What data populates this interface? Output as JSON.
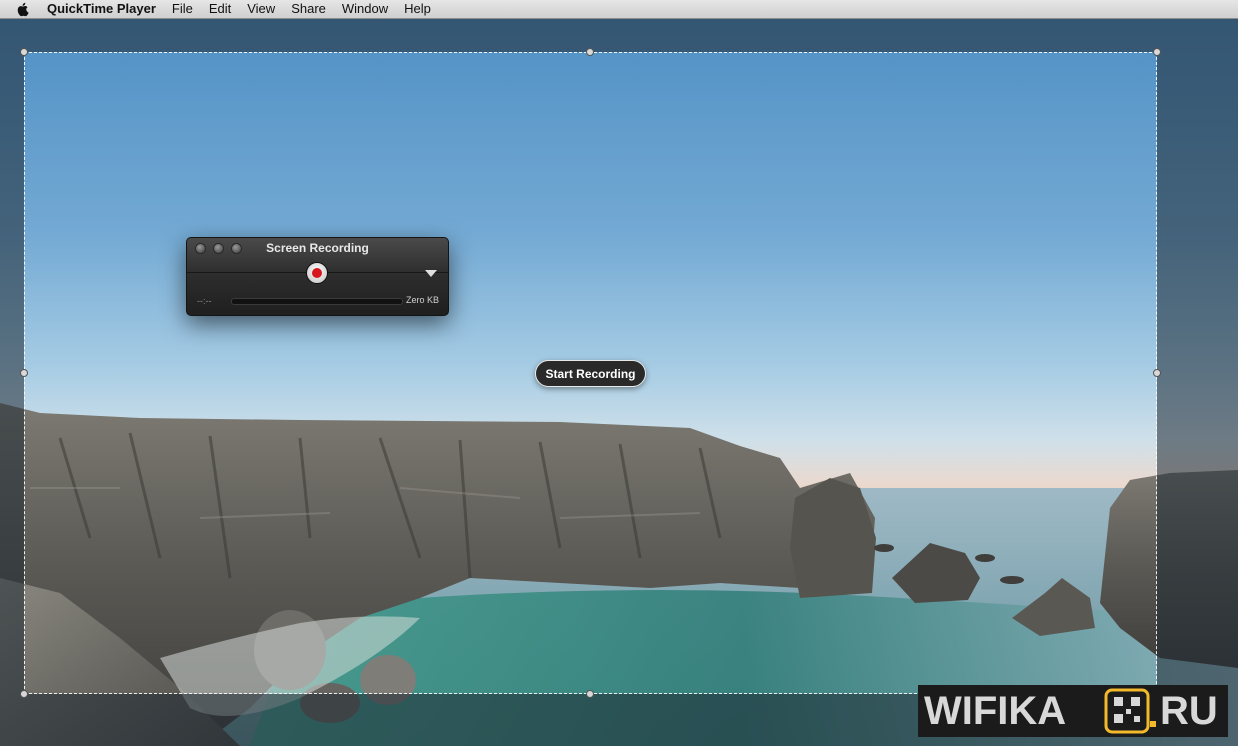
{
  "menubar": {
    "app_name": "QuickTime Player",
    "items": [
      "File",
      "Edit",
      "View",
      "Share",
      "Window",
      "Help"
    ]
  },
  "recording_panel": {
    "title": "Screen Recording",
    "time": "--:--",
    "file_size": "Zero KB"
  },
  "start_button": {
    "label": "Start Recording"
  },
  "watermark": {
    "text": "WIFIKA.RU",
    "colors": {
      "text": "#d8d8d8",
      "accent": "#f2b92c",
      "background": "#1b1b1b"
    }
  },
  "colors": {
    "record_red": "#d7161d",
    "sky_top": "#4f8fc4",
    "sea": "#6fa9b2"
  }
}
